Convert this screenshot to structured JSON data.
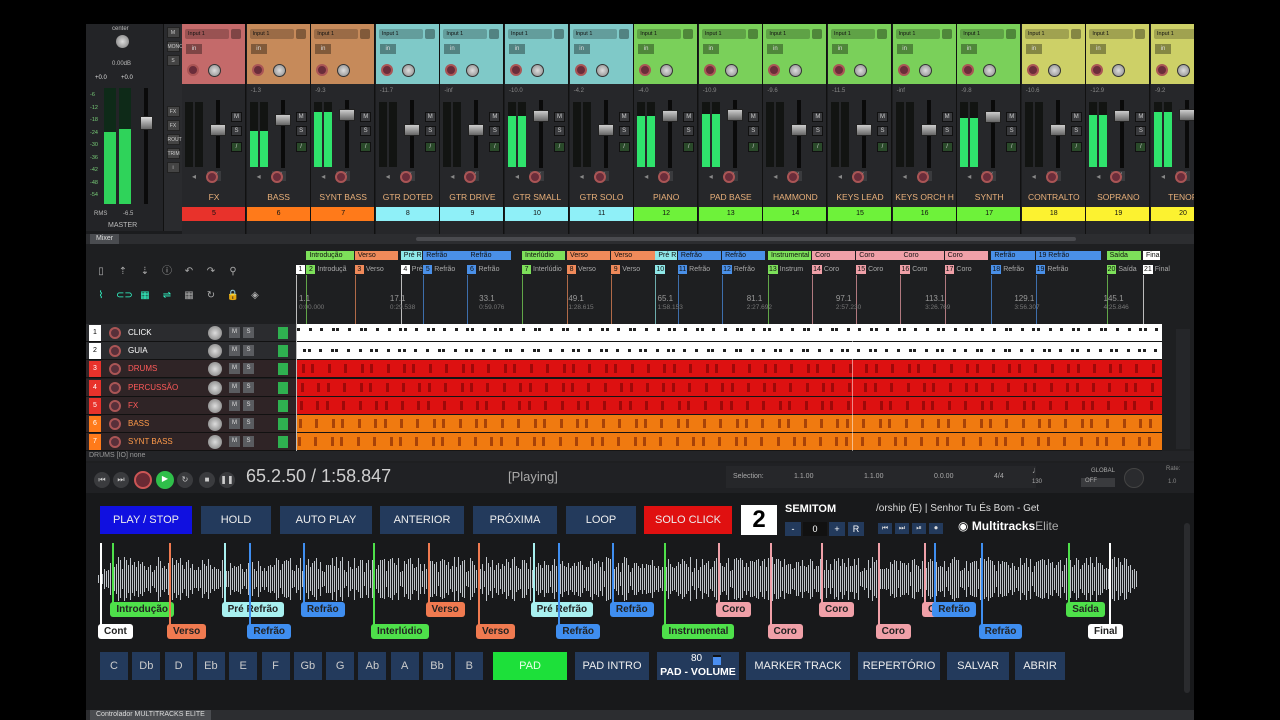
{
  "master": {
    "pan_label": "center",
    "gain": "0.00dB",
    "peak_l": "+0.0",
    "peak_r": "+0.0",
    "rms_label": "RMS",
    "rms_value": "-6.5",
    "name": "MASTER",
    "meter_l": 0.62,
    "meter_r": 0.65,
    "scale": [
      "-6",
      "-12",
      "-18",
      "-24",
      "-30",
      "-36",
      "-42",
      "-48",
      "-54"
    ]
  },
  "mixer_side": {
    "buttons": [
      "M",
      "MONO",
      "S",
      "FX",
      "FX",
      "ROUTE",
      "TRIM",
      "i"
    ]
  },
  "mixer": {
    "input_label": "Input 1",
    "channels": [
      {
        "name": "FX",
        "num": "5",
        "vol": "",
        "color": "#c46a6a",
        "numcolor": "#e8322b",
        "meter": 0.0
      },
      {
        "name": "BASS",
        "num": "6",
        "vol": "-1.3",
        "color": "#c68a5a",
        "numcolor": "#ff7a1a",
        "meter": 0.55
      },
      {
        "name": "SYNT BASS",
        "num": "7",
        "vol": "-9.3",
        "color": "#c68a5a",
        "numcolor": "#ff7a1a",
        "meter": 0.85
      },
      {
        "name": "GTR DOTED",
        "num": "8",
        "vol": "-11.7",
        "color": "#7fc9c8",
        "numcolor": "#8ff0f8",
        "meter": 0.0
      },
      {
        "name": "GTR DRIVE",
        "num": "9",
        "vol": "-inf",
        "color": "#7fc9c8",
        "numcolor": "#8ff0f8",
        "meter": 0.0
      },
      {
        "name": "GTR SMALL",
        "num": "10",
        "vol": "-10.0",
        "color": "#7fc9c8",
        "numcolor": "#8ff0f8",
        "meter": 0.78
      },
      {
        "name": "GTR SOLO",
        "num": "11",
        "vol": "-4.2",
        "color": "#7fc9c8",
        "numcolor": "#8ff0f8",
        "meter": 0.0
      },
      {
        "name": "PIANO",
        "num": "12",
        "vol": "-4.0",
        "color": "#7ad05a",
        "numcolor": "#6ef23a",
        "meter": 0.78
      },
      {
        "name": "PAD BASE",
        "num": "13",
        "vol": "-10.9",
        "color": "#7ad05a",
        "numcolor": "#6ef23a",
        "meter": 0.82
      },
      {
        "name": "HAMMOND",
        "num": "14",
        "vol": "-9.6",
        "color": "#7ad05a",
        "numcolor": "#6ef23a",
        "meter": 0.0
      },
      {
        "name": "KEYS LEAD",
        "num": "15",
        "vol": "-11.5",
        "color": "#7ad05a",
        "numcolor": "#6ef23a",
        "meter": 0.0
      },
      {
        "name": "KEYS ORCH H",
        "num": "16",
        "vol": "-inf",
        "color": "#7ad05a",
        "numcolor": "#6ef23a",
        "meter": 0.0
      },
      {
        "name": "SYNTH",
        "num": "17",
        "vol": "-9.8",
        "color": "#7ad05a",
        "numcolor": "#6ef23a",
        "meter": 0.75
      },
      {
        "name": "CONTRALTO",
        "num": "18",
        "vol": "-10.6",
        "color": "#cdd067",
        "numcolor": "#fcf230",
        "meter": 0.0
      },
      {
        "name": "SOPRANO",
        "num": "19",
        "vol": "-12.9",
        "color": "#cdd067",
        "numcolor": "#fcf230",
        "meter": 0.8
      },
      {
        "name": "TENOR",
        "num": "20",
        "vol": "-9.2",
        "color": "#cdd067",
        "numcolor": "#fcf230",
        "meter": 0.85
      }
    ],
    "tab": "Mixer"
  },
  "arrange": {
    "regions": [
      {
        "label": "Introdução",
        "pos": 0.012,
        "w": 0.055,
        "color": "#7de05a"
      },
      {
        "label": "Verso",
        "pos": 0.068,
        "w": 0.05,
        "color": "#f08a5a"
      },
      {
        "label": "Pré R",
        "pos": 0.121,
        "w": 0.025,
        "color": "#8fe8e8"
      },
      {
        "label": "Refrão",
        "pos": 0.147,
        "w": 0.05,
        "color": "#4a90e8"
      },
      {
        "label": "Refrão",
        "pos": 0.198,
        "w": 0.05,
        "color": "#4a90e8"
      },
      {
        "label": "Interlúdio",
        "pos": 0.261,
        "w": 0.05,
        "color": "#7de05a"
      },
      {
        "label": "Verso",
        "pos": 0.313,
        "w": 0.05,
        "color": "#f08a5a"
      },
      {
        "label": "Verso",
        "pos": 0.364,
        "w": 0.05,
        "color": "#f08a5a"
      },
      {
        "label": "Pré R",
        "pos": 0.415,
        "w": 0.025,
        "color": "#8fe8e8"
      },
      {
        "label": "Refrão",
        "pos": 0.441,
        "w": 0.05,
        "color": "#4a90e8"
      },
      {
        "label": "Refrão",
        "pos": 0.492,
        "w": 0.05,
        "color": "#4a90e8"
      },
      {
        "label": "Instrumental",
        "pos": 0.545,
        "w": 0.05,
        "color": "#7de05a"
      },
      {
        "label": "Coro",
        "pos": 0.596,
        "w": 0.05,
        "color": "#f0a0a8"
      },
      {
        "label": "Coro",
        "pos": 0.647,
        "w": 0.05,
        "color": "#f0a0a8"
      },
      {
        "label": "Coro",
        "pos": 0.698,
        "w": 0.05,
        "color": "#f0a0a8"
      },
      {
        "label": "Coro",
        "pos": 0.749,
        "w": 0.05,
        "color": "#f0a0a8"
      },
      {
        "label": "Refrão",
        "pos": 0.803,
        "w": 0.05,
        "color": "#4a90e8"
      },
      {
        "label": "19 Refrão",
        "pos": 0.854,
        "w": 0.075,
        "color": "#4a90e8"
      },
      {
        "label": "Saída",
        "pos": 0.936,
        "w": 0.04,
        "color": "#7de05a"
      },
      {
        "label": "Fina",
        "pos": 0.978,
        "w": 0.02,
        "color": "#ffffff"
      }
    ],
    "markers": [
      {
        "n": "1",
        "label": "",
        "pos": 0.0,
        "color": "#ffffff"
      },
      {
        "n": "2",
        "label": "Introduçã",
        "pos": 0.012,
        "color": "#7de05a"
      },
      {
        "n": "3",
        "label": "Verso",
        "pos": 0.068,
        "color": "#f08a5a"
      },
      {
        "n": "4",
        "label": "Pré",
        "pos": 0.121,
        "color": "#ffffff"
      },
      {
        "n": "5",
        "label": "Refrão",
        "pos": 0.147,
        "color": "#4a90e8"
      },
      {
        "n": "6",
        "label": "Refrão",
        "pos": 0.198,
        "color": "#4a90e8"
      },
      {
        "n": "7",
        "label": "Interlúdio",
        "pos": 0.261,
        "color": "#7de05a"
      },
      {
        "n": "8",
        "label": "Verso",
        "pos": 0.313,
        "color": "#f08a5a"
      },
      {
        "n": "9",
        "label": "Verso",
        "pos": 0.364,
        "color": "#f08a5a"
      },
      {
        "n": "10",
        "label": "",
        "pos": 0.415,
        "color": "#8fe8e8"
      },
      {
        "n": "11",
        "label": "Refrão",
        "pos": 0.441,
        "color": "#4a90e8"
      },
      {
        "n": "12",
        "label": "Refrão",
        "pos": 0.492,
        "color": "#4a90e8"
      },
      {
        "n": "13",
        "label": "Instrum",
        "pos": 0.545,
        "color": "#7de05a"
      },
      {
        "n": "14",
        "label": "Coro",
        "pos": 0.596,
        "color": "#f0a0a8"
      },
      {
        "n": "15",
        "label": "Coro",
        "pos": 0.647,
        "color": "#f0a0a8"
      },
      {
        "n": "16",
        "label": "Coro",
        "pos": 0.698,
        "color": "#f0a0a8"
      },
      {
        "n": "17",
        "label": "Coro",
        "pos": 0.749,
        "color": "#f0a0a8"
      },
      {
        "n": "18",
        "label": "Refrão",
        "pos": 0.803,
        "color": "#4a90e8"
      },
      {
        "n": "19",
        "label": "Refrão",
        "pos": 0.854,
        "color": "#4a90e8"
      },
      {
        "n": "20",
        "label": "Saída",
        "pos": 0.936,
        "color": "#7de05a"
      },
      {
        "n": "21",
        "label": "Final",
        "pos": 0.978,
        "color": "#ffffff"
      }
    ],
    "ruler": [
      {
        "bar": "1.1",
        "time": "0:00.000",
        "pos": 0.0
      },
      {
        "bar": "17.1",
        "time": "0:29.538",
        "pos": 0.105
      },
      {
        "bar": "33.1",
        "time": "0:59.076",
        "pos": 0.208
      },
      {
        "bar": "49.1",
        "time": "1:28.615",
        "pos": 0.311
      },
      {
        "bar": "65.1",
        "time": "1:58.153",
        "pos": 0.414
      },
      {
        "bar": "81.1",
        "time": "2:27.692",
        "pos": 0.517
      },
      {
        "bar": "97.1",
        "time": "2:57.230",
        "pos": 0.62
      },
      {
        "bar": "113.1",
        "time": "3:26.769",
        "pos": 0.723
      },
      {
        "bar": "129.1",
        "time": "3:56.307",
        "pos": 0.826
      },
      {
        "bar": "145.1",
        "time": "4:25.846",
        "pos": 0.929
      }
    ],
    "tracks": [
      {
        "n": "1",
        "name": "CLICK",
        "color": "#ffffff",
        "textcolor": "#ffffff",
        "lane": "#ffffff"
      },
      {
        "n": "2",
        "name": "GUIA",
        "color": "#ffffff",
        "textcolor": "#ffffff",
        "lane": "#ffffff"
      },
      {
        "n": "3",
        "name": "DRUMS",
        "color": "#e8322b",
        "textcolor": "#ff5a5a",
        "lane": "#d11"
      },
      {
        "n": "4",
        "name": "PERCUSSÃO",
        "color": "#e8322b",
        "textcolor": "#ff5a5a",
        "lane": "#d11"
      },
      {
        "n": "5",
        "name": "FX",
        "color": "#e8322b",
        "textcolor": "#ff5a5a",
        "lane": "#d11"
      },
      {
        "n": "6",
        "name": "BASS",
        "color": "#ff7a1a",
        "textcolor": "#ff9a4a",
        "lane": "#f07a10"
      },
      {
        "n": "7",
        "name": "SYNT BASS",
        "color": "#ff7a1a",
        "textcolor": "#ff9a4a",
        "lane": "#f07a10"
      }
    ],
    "track_m": "M",
    "track_s": "S",
    "footer": "DRUMS [IO] none",
    "toolbar_icons": [
      "page-icon",
      "import-icon",
      "export-icon",
      "info-icon",
      "undo-icon",
      "redo-icon",
      "metronome-icon",
      "ripple-icon",
      "link-icon",
      "grid-icon",
      "snap-icon",
      "grid2-icon",
      "loop-icon",
      "lock-icon",
      "box-icon"
    ]
  },
  "transport": {
    "position": "65.2.50 / 1:58.847",
    "state": "[Playing]",
    "selection_label": "Selection:",
    "sel_start": "1.1.00",
    "sel_end": "1.1.00",
    "sel_len": "0.0.00",
    "timesig": "4/4",
    "bpm": "130",
    "global": "GLOBAL",
    "global_state": "OFF",
    "rate_label": "Rate:",
    "rate": "1.0"
  },
  "controller": {
    "buttons": {
      "play_stop": "PLAY / STOP",
      "hold": "HOLD",
      "auto_play": "AUTO PLAY",
      "anterior": "ANTERIOR",
      "proxima": "PRÓXIMA",
      "loop": "LOOP",
      "solo_click": "SOLO CLICK"
    },
    "semitone": {
      "value": "2",
      "label": "SEMITOM",
      "minus": "-",
      "zero": "0",
      "plus": "+",
      "reset": "R"
    },
    "song": "/orship (E)  |  Senhor Tu És Bom - Get",
    "logo_main": "Multitracks",
    "logo_sub": "Elite",
    "player_icons": [
      "⏮",
      "⏭",
      "⏯",
      "⏺"
    ],
    "sections_top": [
      {
        "label": "Introdução",
        "x": 0.012,
        "color": "#4ee04a"
      },
      {
        "label": "Pré Refrão",
        "x": 0.12,
        "color": "#a8f0f0"
      },
      {
        "label": "Refrão",
        "x": 0.197,
        "color": "#3f8ef0"
      },
      {
        "label": "Verso",
        "x": 0.318,
        "color": "#f07a50"
      },
      {
        "label": "Pré Refrão",
        "x": 0.42,
        "color": "#a8f0f0"
      },
      {
        "label": "Refrão",
        "x": 0.497,
        "color": "#3f8ef0"
      },
      {
        "label": "Coro",
        "x": 0.6,
        "color": "#f0a0a8"
      },
      {
        "label": "Coro",
        "x": 0.7,
        "color": "#f0a0a8"
      },
      {
        "label": "Coro",
        "x": 0.8,
        "color": "#f0a0a8"
      },
      {
        "label": "Refrão",
        "x": 0.81,
        "color": "#3f8ef0"
      },
      {
        "label": "Saída",
        "x": 0.94,
        "color": "#4ee04a"
      }
    ],
    "sections_bottom": [
      {
        "label": "Cont",
        "x": 0.0,
        "color": "#ffffff"
      },
      {
        "label": "Verso",
        "x": 0.067,
        "color": "#f07a50"
      },
      {
        "label": "Refrão",
        "x": 0.145,
        "color": "#3f8ef0"
      },
      {
        "label": "Interlúdio",
        "x": 0.265,
        "color": "#4ee04a"
      },
      {
        "label": "Verso",
        "x": 0.367,
        "color": "#f07a50"
      },
      {
        "label": "Refrão",
        "x": 0.445,
        "color": "#3f8ef0"
      },
      {
        "label": "Instrumental",
        "x": 0.548,
        "color": "#4ee04a"
      },
      {
        "label": "Coro",
        "x": 0.65,
        "color": "#f0a0a8"
      },
      {
        "label": "Coro",
        "x": 0.755,
        "color": "#f0a0a8"
      },
      {
        "label": "Refrão",
        "x": 0.855,
        "color": "#3f8ef0"
      },
      {
        "label": "Final",
        "x": 0.98,
        "color": "#ffffff"
      }
    ],
    "keys": [
      "C",
      "Db",
      "D",
      "Eb",
      "E",
      "F",
      "Gb",
      "G",
      "Ab",
      "A",
      "Bb",
      "B"
    ],
    "pad": "PAD",
    "pad_intro": "PAD INTRO",
    "pad_volume_value": "80",
    "pad_volume_label": "PAD - VOLUME",
    "pad_volume_level": 0.8,
    "marker_track": "MARKER TRACK",
    "repertorio": "REPERTÓRIO",
    "salvar": "SALVAR",
    "abrir": "ABRIR",
    "tab": "Controlador MULTITRACKS ELITE"
  }
}
